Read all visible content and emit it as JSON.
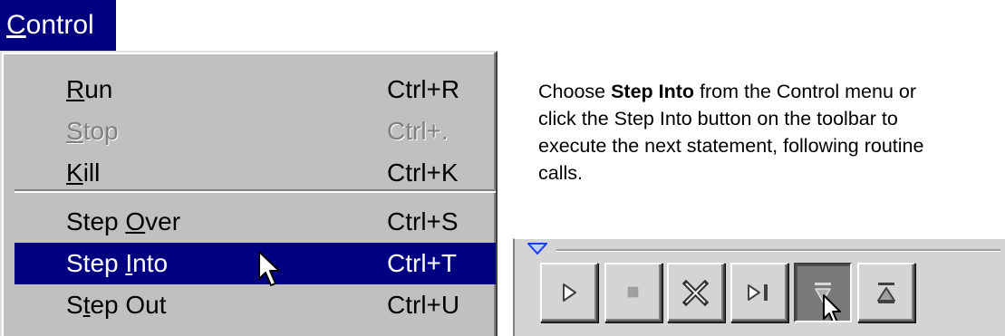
{
  "menu": {
    "title": "Control",
    "items": [
      {
        "label": "Run",
        "shortcut": "Ctrl+R",
        "state": "normal"
      },
      {
        "label": "Stop",
        "shortcut": "Ctrl+.",
        "state": "disabled"
      },
      {
        "label": "Kill",
        "shortcut": "Ctrl+K",
        "state": "normal"
      },
      {
        "label": "Step Over",
        "shortcut": "Ctrl+S",
        "state": "normal"
      },
      {
        "label": "Step Into",
        "shortcut": "Ctrl+T",
        "state": "selected"
      },
      {
        "label": "Step Out",
        "shortcut": "Ctrl+U",
        "state": "normal"
      }
    ]
  },
  "description": {
    "pre": "Choose ",
    "bold": "Step Into",
    "post": "  from the Control menu or click the Step Into button on the toolbar to execute the next statement, following routine calls."
  },
  "toolbar": {
    "buttons": [
      {
        "icon": "run-icon",
        "state": "normal"
      },
      {
        "icon": "stop-icon",
        "state": "disabled"
      },
      {
        "icon": "kill-icon",
        "state": "normal"
      },
      {
        "icon": "step-over-icon",
        "state": "normal"
      },
      {
        "icon": "step-into-icon",
        "state": "pressed"
      },
      {
        "icon": "step-out-icon",
        "state": "normal"
      }
    ]
  },
  "colors": {
    "selection": "#000080",
    "menu_background": "#c0c0c0",
    "disabled_text": "#808080"
  }
}
